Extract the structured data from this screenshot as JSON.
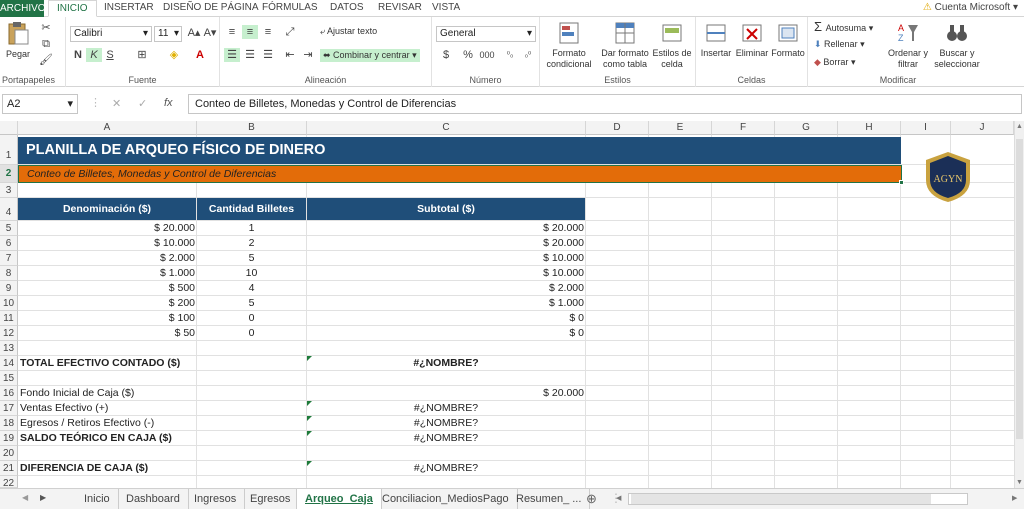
{
  "ribbon_tabs": [
    "ARCHIVO",
    "INICIO",
    "INSERTAR",
    "DISEÑO DE PÁGINA",
    "FÓRMULAS",
    "DATOS",
    "REVISAR",
    "VISTA"
  ],
  "account": "Cuenta Microsoft",
  "clipboard": {
    "paste": "Pegar",
    "group": "Portapapeles"
  },
  "font": {
    "name": "Calibri",
    "size": "11",
    "bold": "N",
    "italic": "K",
    "underline": "S",
    "group": "Fuente"
  },
  "alignment": {
    "wrap": "Ajustar texto",
    "merge": "Combinar y centrar",
    "group": "Alineación"
  },
  "number": {
    "format": "General",
    "currency": "$",
    "percent": "%",
    "thousands": "000",
    "group": "Número"
  },
  "styles": {
    "conditional": "Formato condicional",
    "table": "Dar formato como tabla",
    "cell": "Estilos de celda",
    "group": "Estilos"
  },
  "cells": {
    "insert": "Insertar",
    "delete": "Eliminar",
    "format": "Formato",
    "group": "Celdas"
  },
  "editing": {
    "autosum": "Autosuma",
    "fill": "Rellenar",
    "clear": "Borrar",
    "sort": "Ordenar y filtrar",
    "find": "Buscar y seleccionar",
    "group": "Modificar"
  },
  "formula_bar": {
    "cell_ref": "A2",
    "fx": "fx",
    "content": "Conteo de Billetes, Monedas y Control de Diferencias"
  },
  "columns": [
    "A",
    "B",
    "C",
    "D",
    "E",
    "F",
    "G",
    "H",
    "I",
    "J"
  ],
  "rows": [
    "1",
    "2",
    "3",
    "4",
    "5",
    "6",
    "7",
    "8",
    "9",
    "10",
    "11",
    "12",
    "13",
    "14",
    "15",
    "16",
    "17",
    "18",
    "19",
    "20",
    "21",
    "22"
  ],
  "sheet": {
    "title": "PLANILLA DE ARQUEO FÍSICO DE DINERO",
    "subtitle": "Conteo de Billetes, Monedas y Control de Diferencias",
    "logo_text": "AGYN",
    "headers": [
      "Denominación ($)",
      "Cantidad Billetes",
      "Subtotal ($)"
    ],
    "table": [
      {
        "denom": "$ 20.000",
        "qty": "1",
        "subtotal": "$ 20.000"
      },
      {
        "denom": "$ 10.000",
        "qty": "2",
        "subtotal": "$ 20.000"
      },
      {
        "denom": "$ 2.000",
        "qty": "5",
        "subtotal": "$ 10.000"
      },
      {
        "denom": "$ 1.000",
        "qty": "10",
        "subtotal": "$ 10.000"
      },
      {
        "denom": "$ 500",
        "qty": "4",
        "subtotal": "$ 2.000"
      },
      {
        "denom": "$ 200",
        "qty": "5",
        "subtotal": "$ 1.000"
      },
      {
        "denom": "$ 100",
        "qty": "0",
        "subtotal": "$ 0"
      },
      {
        "denom": "$ 50",
        "qty": "0",
        "subtotal": "$ 0"
      }
    ],
    "total_label": "TOTAL EFECTIVO CONTADO ($)",
    "total_value": "#¿NOMBRE?",
    "fondo_label": "Fondo Inicial de Caja ($)",
    "fondo_value": "$ 20.000",
    "ventas_label": "Ventas Efectivo (+)",
    "ventas_value": "#¿NOMBRE?",
    "egresos_label": "Egresos / Retiros Efectivo (-)",
    "egresos_value": "#¿NOMBRE?",
    "saldo_label": "SALDO TEÓRICO EN CAJA ($)",
    "saldo_value": "#¿NOMBRE?",
    "dif_label": "DIFERENCIA DE CAJA ($)",
    "dif_value": "#¿NOMBRE?"
  },
  "sheet_tabs": [
    "Inicio",
    "Dashboard",
    "Ingresos",
    "Egresos",
    "Arqueo_Caja",
    "Conciliacion_MediosPago",
    "Resumen_ ..."
  ],
  "active_sheet": "Arqueo_Caja",
  "colors": {
    "excel_green": "#217346",
    "title_bg": "#1f4e79",
    "subtitle_bg": "#e36c09"
  }
}
